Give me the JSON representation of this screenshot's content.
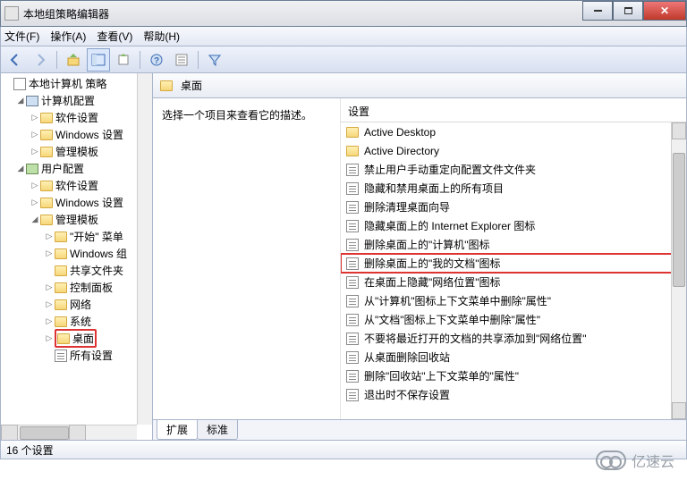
{
  "window": {
    "title": "本地组策略编辑器"
  },
  "menu": {
    "file": "文件(F)",
    "action": "操作(A)",
    "view": "查看(V)",
    "help": "帮助(H)"
  },
  "tree": {
    "root": "本地计算机 策略",
    "computer_cfg": "计算机配置",
    "c_software": "软件设置",
    "c_windows": "Windows 设置",
    "c_templates": "管理模板",
    "user_cfg": "用户配置",
    "u_software": "软件设置",
    "u_windows": "Windows 设置",
    "u_templates": "管理模板",
    "start_menu": "\"开始\" 菜单",
    "windows_comp": "Windows 组",
    "shared_folders": "共享文件夹",
    "control_panel": "控制面板",
    "network": "网络",
    "system": "系统",
    "desktop": "桌面",
    "all_settings": "所有设置"
  },
  "right": {
    "header": "桌面",
    "hint": "选择一个项目来查看它的描述。",
    "col_header": "设置",
    "items": [
      {
        "type": "folder",
        "label": "Active Desktop"
      },
      {
        "type": "folder",
        "label": "Active Directory"
      },
      {
        "type": "setting",
        "label": "禁止用户手动重定向配置文件文件夹"
      },
      {
        "type": "setting",
        "label": "隐藏和禁用桌面上的所有项目"
      },
      {
        "type": "setting",
        "label": "删除清理桌面向导"
      },
      {
        "type": "setting",
        "label": "隐藏桌面上的 Internet Explorer 图标"
      },
      {
        "type": "setting",
        "label": "删除桌面上的\"计算机\"图标"
      },
      {
        "type": "setting",
        "label": "删除桌面上的\"我的文档\"图标",
        "highlight": true
      },
      {
        "type": "setting",
        "label": "在桌面上隐藏\"网络位置\"图标"
      },
      {
        "type": "setting",
        "label": "从\"计算机\"图标上下文菜单中删除\"属性\""
      },
      {
        "type": "setting",
        "label": "从\"文档\"图标上下文菜单中删除\"属性\""
      },
      {
        "type": "setting",
        "label": "不要将最近打开的文档的共享添加到\"网络位置\""
      },
      {
        "type": "setting",
        "label": "从桌面删除回收站"
      },
      {
        "type": "setting",
        "label": "删除\"回收站\"上下文菜单的\"属性\""
      },
      {
        "type": "setting",
        "label": "退出时不保存设置"
      }
    ]
  },
  "tabs": {
    "extended": "扩展",
    "standard": "标准"
  },
  "status": {
    "text": "16 个设置"
  },
  "watermark": {
    "text": "亿速云"
  }
}
